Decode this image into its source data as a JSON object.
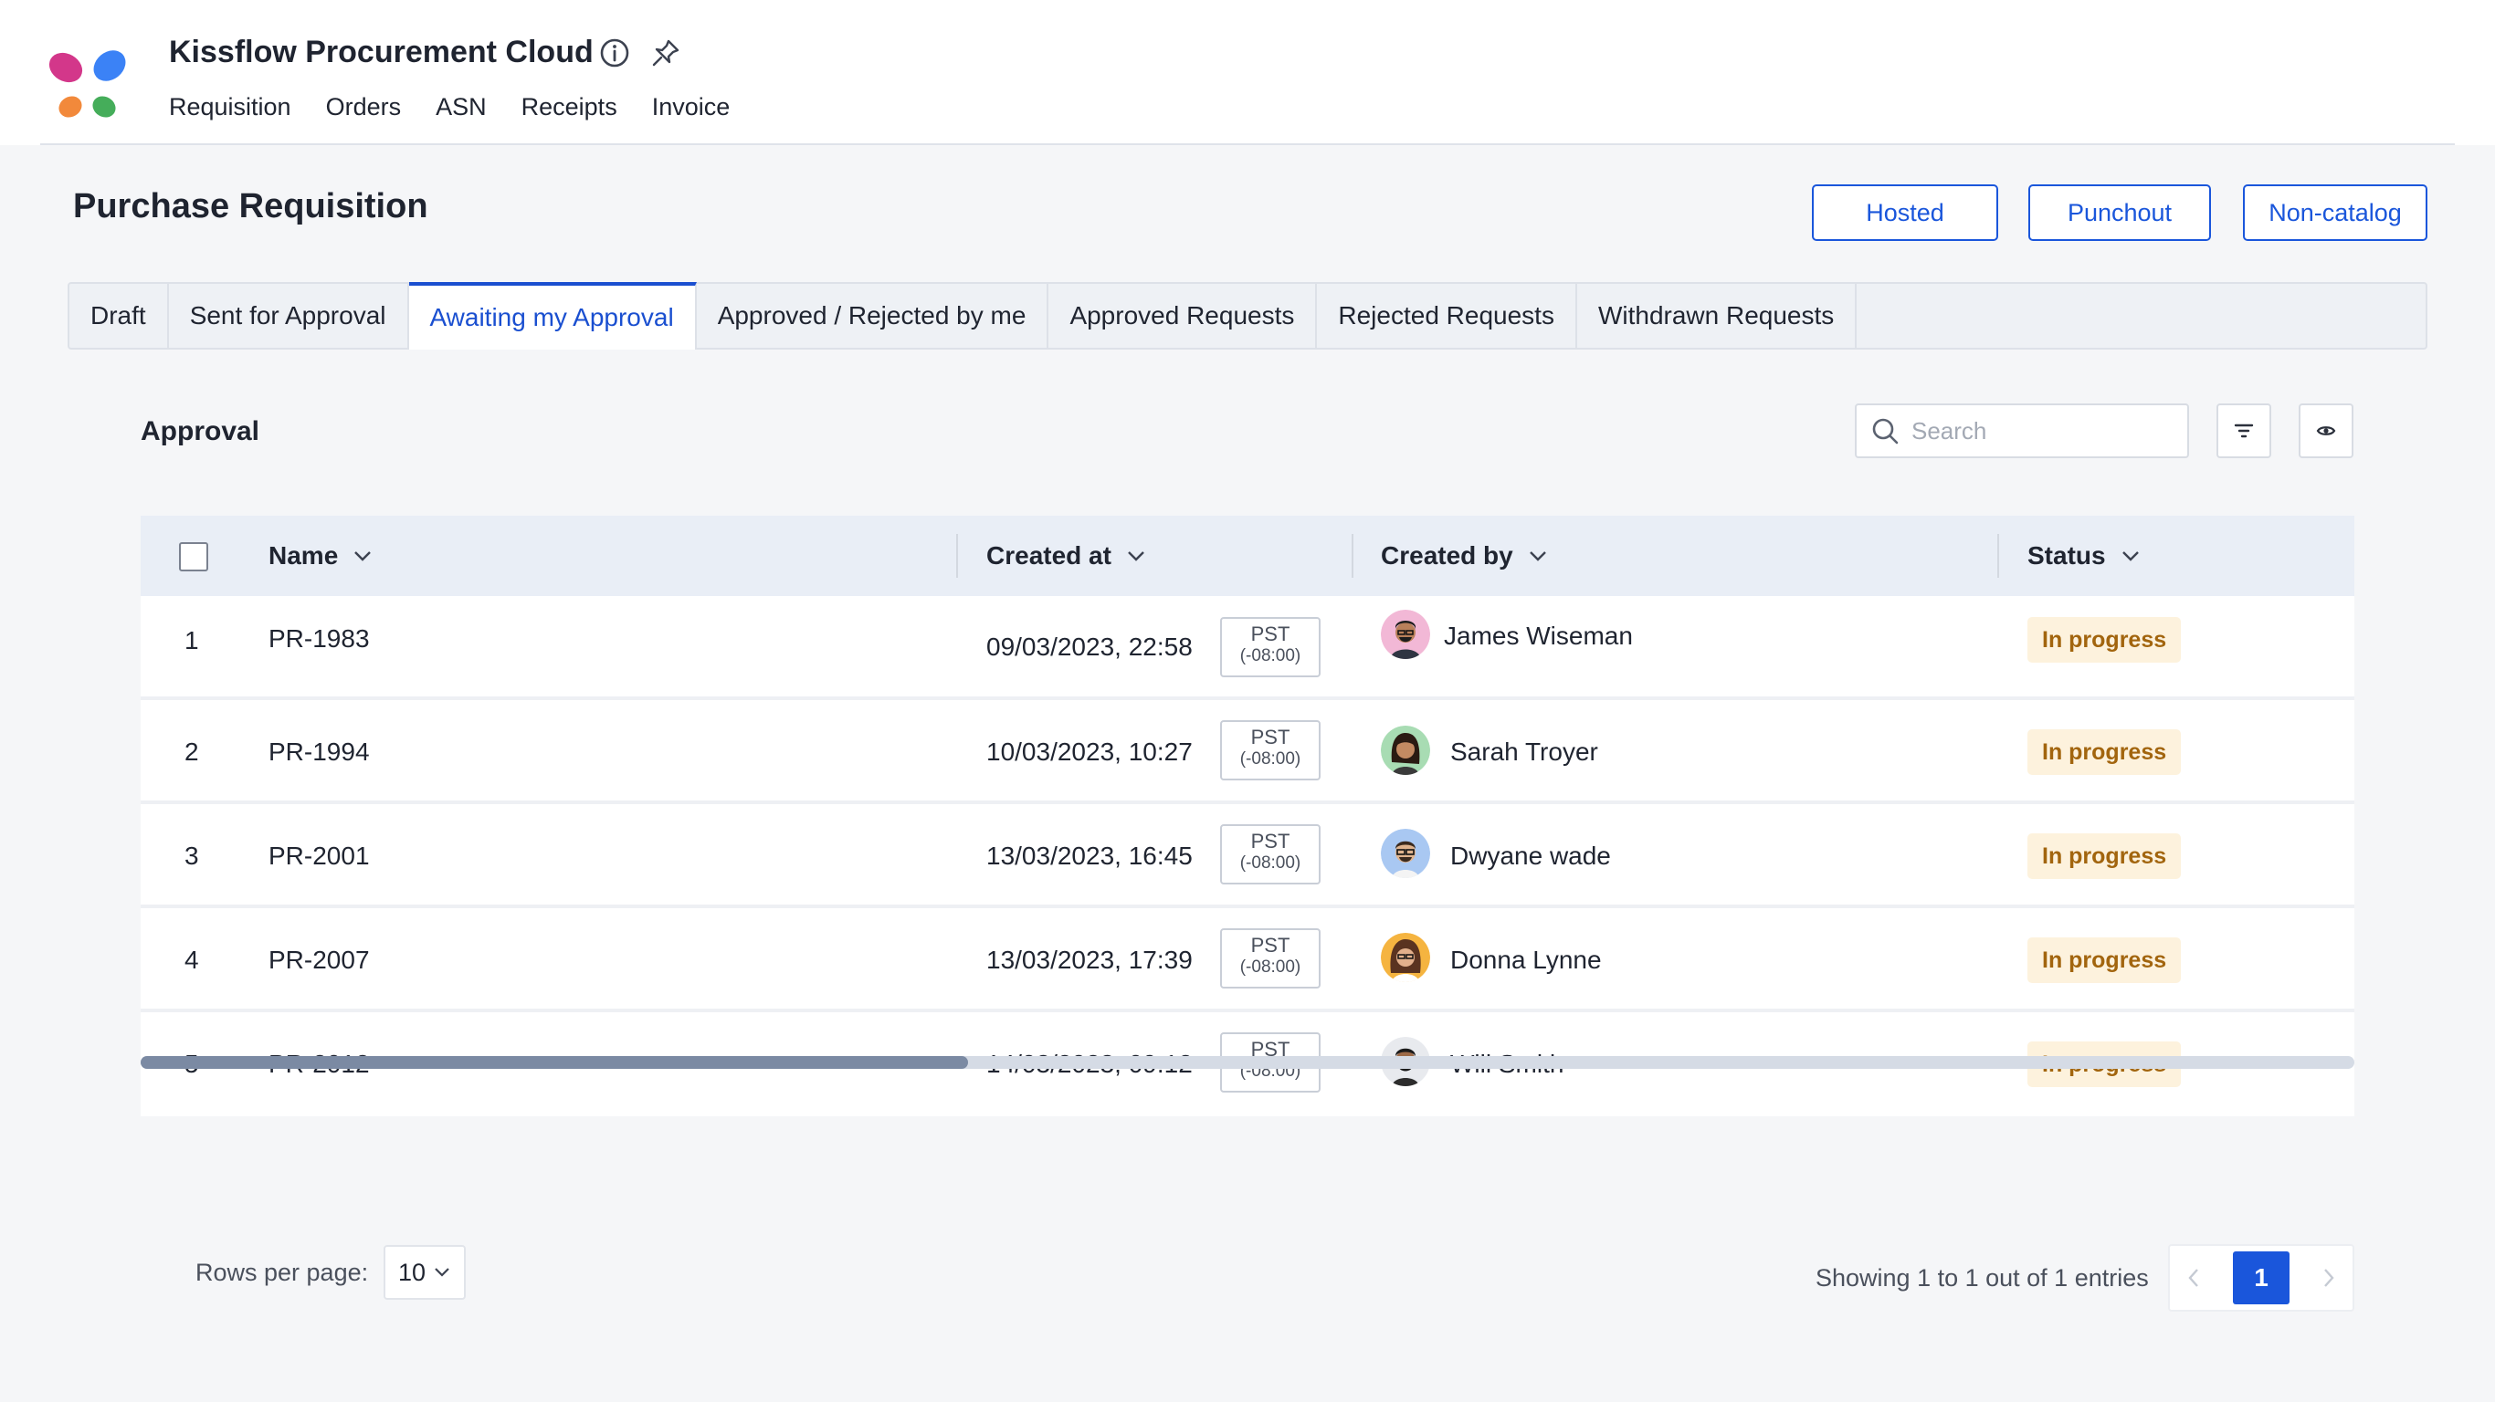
{
  "app": {
    "title": "Kissflow Procurement Cloud",
    "nav": [
      "Requisition",
      "Orders",
      "ASN",
      "Receipts",
      "Invoice"
    ]
  },
  "page": {
    "title": "Purchase Requisition",
    "buttons": {
      "hosted": "Hosted",
      "punchout": "Punchout",
      "non_catalog": "Non-catalog"
    }
  },
  "tabs": [
    {
      "label": "Draft",
      "active": false
    },
    {
      "label": "Sent for Approval",
      "active": false
    },
    {
      "label": "Awaiting my Approval",
      "active": true
    },
    {
      "label": "Approved / Rejected by me",
      "active": false
    },
    {
      "label": "Approved Requests",
      "active": false
    },
    {
      "label": "Rejected Requests",
      "active": false
    },
    {
      "label": "Withdrawn Requests",
      "active": false
    }
  ],
  "section": {
    "title": "Approval",
    "search_placeholder": "Search"
  },
  "table": {
    "columns": {
      "name": "Name",
      "created_at": "Created at",
      "created_by": "Created by",
      "status": "Status"
    },
    "rows": [
      {
        "index": "1",
        "name": "PR-1983",
        "created_at": "09/03/2023, 22:58",
        "tz": "PST",
        "tz_offset": "(-08:00)",
        "created_by": "James Wiseman",
        "status": "In progress"
      },
      {
        "index": "2",
        "name": "PR-1994",
        "created_at": "10/03/2023, 10:27",
        "tz": "PST",
        "tz_offset": "(-08:00)",
        "created_by": "Sarah Troyer",
        "status": "In progress"
      },
      {
        "index": "3",
        "name": "PR-2001",
        "created_at": "13/03/2023, 16:45",
        "tz": "PST",
        "tz_offset": "(-08:00)",
        "created_by": "Dwyane wade",
        "status": "In progress"
      },
      {
        "index": "4",
        "name": "PR-2007",
        "created_at": "13/03/2023, 17:39",
        "tz": "PST",
        "tz_offset": "(-08:00)",
        "created_by": "Donna Lynne",
        "status": "In progress"
      },
      {
        "index": "5",
        "name": "PR-2012",
        "created_at": "14/03/2023, 09:12",
        "tz": "PST",
        "tz_offset": "(-08:00)",
        "created_by": "Will Smith",
        "status": "In progress"
      }
    ]
  },
  "footer": {
    "rows_per_page_label": "Rows per page:",
    "rows_per_page_value": "10",
    "showing": "Showing 1 to 1 out of 1 entries",
    "current_page": "1"
  },
  "colors": {
    "accent": "#1a56db",
    "status_bg": "#fdf2dd",
    "status_text": "#a2650e"
  }
}
